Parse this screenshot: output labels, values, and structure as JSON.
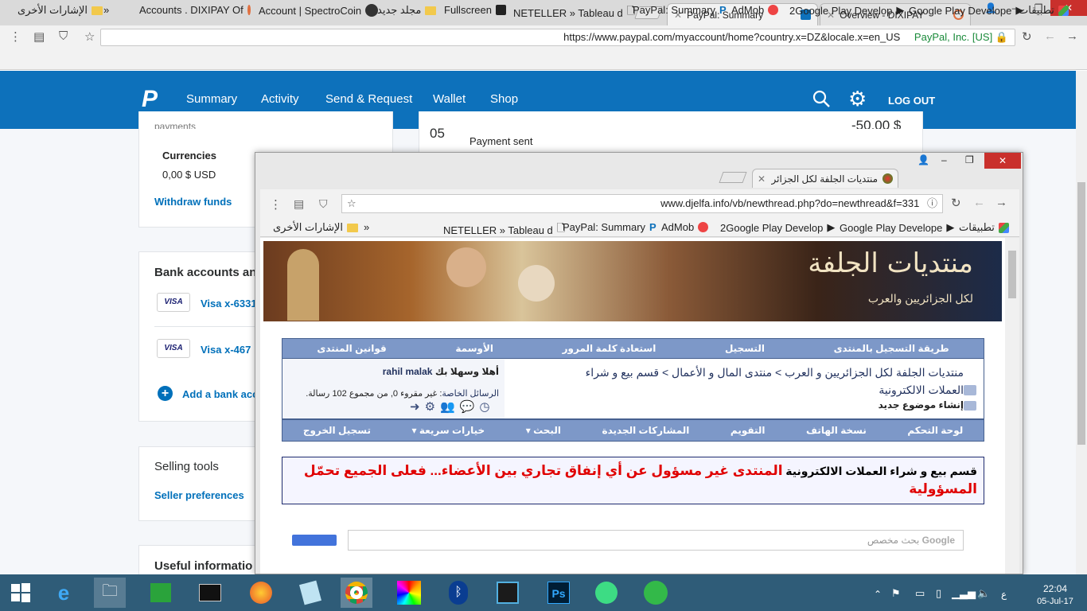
{
  "browser": {
    "tabs": [
      {
        "label": "PayPal: Summary",
        "close": "×"
      },
      {
        "label": "Overview - DIXIPAY",
        "close": "×"
      }
    ],
    "window_buttons": {
      "min": "‒",
      "max": "❐",
      "close": "✕"
    },
    "url_main": "https://www.paypal.com/myaccount/home?country.x=DZ&locale.x=en_US",
    "url_secure": "PayPal, Inc. [US]",
    "bookmarks": [
      {
        "label": "تطبيقات"
      },
      {
        "label": "Google Play Develope"
      },
      {
        "label": "2Google Play Develop"
      },
      {
        "label": "AdMob"
      },
      {
        "label": "PayPal: Summary"
      },
      {
        "label": "NETELLER » Tableau d"
      },
      {
        "label": "Fullscreen"
      },
      {
        "label": "مجلد جديد"
      },
      {
        "label": "Account | SpectroCoin"
      },
      {
        "label": "Accounts . DIXIPAY Of"
      }
    ],
    "other_bookmarks": "الإشارات الأخرى",
    "more": "»"
  },
  "paypal": {
    "nav": [
      "Summary",
      "Activity",
      "Send & Request",
      "Wallet",
      "Shop"
    ],
    "logout": "LOG OUT",
    "left": {
      "payments_partial": "payments",
      "currencies_title": "Currencies",
      "currency_value": "0,00 $ USD",
      "withdraw": "Withdraw funds",
      "bank_title": "Bank accounts an",
      "cards": [
        {
          "brand": "VISA",
          "label": "Visa x-6331"
        },
        {
          "brand": "VISA",
          "label": "Visa x-467"
        }
      ],
      "add_bank": "Add a bank acc",
      "selling_title": "Selling tools",
      "seller_prefs": "Seller preferences",
      "useful_title": "Useful informatio"
    },
    "activity": {
      "day": "05",
      "desc": "Payment sent",
      "amount": "-50,00 $"
    }
  },
  "window2": {
    "tab_label": "منتديات الجلفة لكل الجزائر",
    "url": "www.djelfa.info/vb/newthread.php?do=newthread&f=331",
    "bookmarks": [
      {
        "label": "تطبيقات"
      },
      {
        "label": "Google Play Develope"
      },
      {
        "label": "2Google Play Develop"
      },
      {
        "label": "AdMob"
      },
      {
        "label": "PayPal: Summary"
      },
      {
        "label": "NETELLER » Tableau d"
      }
    ],
    "other_bookmarks": "الإشارات الأخرى",
    "more": "»"
  },
  "forum": {
    "logo_title": "منتديات الجلفة",
    "logo_subtitle": "لكل الجزائريين والعرب",
    "top_nav": [
      "طريقة التسجيل بالمنتدى",
      "التسجيل",
      "استعادة كلمة المرور",
      "الأوسمة",
      "قوانين المنتدى"
    ],
    "breadcrumb": "منتديات الجلفة لكل الجزائريين و العرب > منتدى المال و الأعمال > قسم بيع و شراء",
    "breadcrumb_current": "العملات الالكترونية",
    "create_topic": "إنشاء موضوع جديد",
    "welcome_prefix": "أهلا وسهلا بك",
    "username": "rahil malak",
    "pm_label": "الرسائل الخاصة",
    "pm_text": ": غير مقروء 0, من مجموع 102 رسالة.",
    "bottom_nav": [
      "لوحة التحكم",
      "نسخة الهاتف",
      "التقويم",
      "المشاركات الجديدة",
      "البحث",
      "خيارات سريعة",
      "تسجيل الخروج"
    ],
    "notice_black": "قسم بيع و شراء العملات الالكترونية",
    "notice_red": "المنتدى غير مسؤول عن أي إنفاق تجاري بين الأعضاء... فعلى الجميع تحمّل المسؤولية",
    "search_brand": "Google",
    "search_placeholder": "بحث مخصص"
  },
  "taskbar": {
    "clock_time": "22:04",
    "clock_date": "05-Jul-17",
    "lang": "ع"
  },
  "colors": {
    "paypal_blue": "#0d71bb",
    "link_blue": "#0070ba",
    "forum_nav": "#7d98c8",
    "notice_red": "#e00000",
    "taskbar": "#2f5c78"
  }
}
